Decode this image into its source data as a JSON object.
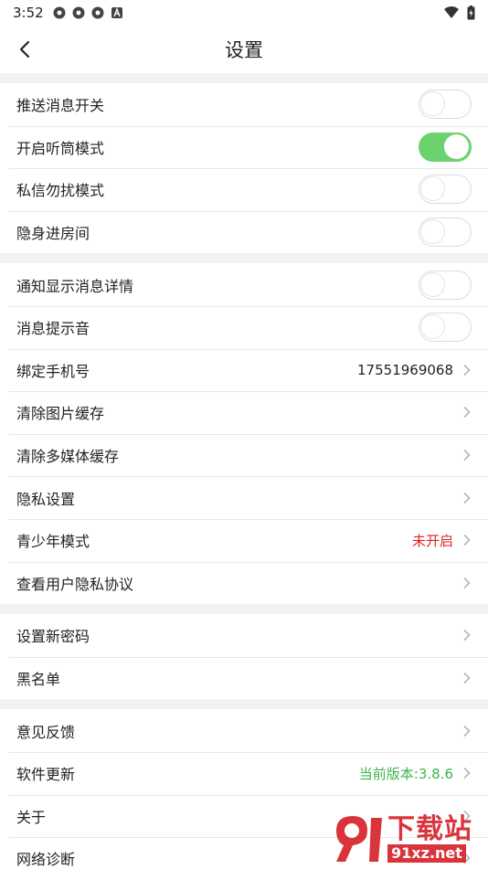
{
  "status_bar": {
    "time": "3:52"
  },
  "header": {
    "title": "设置"
  },
  "groups": [
    [
      {
        "label": "推送消息开关",
        "type": "toggle",
        "on": false
      },
      {
        "label": "开启听筒模式",
        "type": "toggle",
        "on": true
      },
      {
        "label": "私信勿扰模式",
        "type": "toggle",
        "on": false
      },
      {
        "label": "隐身进房间",
        "type": "toggle",
        "on": false
      }
    ],
    [
      {
        "label": "通知显示消息详情",
        "type": "toggle",
        "on": false
      },
      {
        "label": "消息提示音",
        "type": "toggle",
        "on": false
      },
      {
        "label": "绑定手机号",
        "type": "link",
        "value": "17551969068",
        "value_color": "default"
      },
      {
        "label": "清除图片缓存",
        "type": "link"
      },
      {
        "label": "清除多媒体缓存",
        "type": "link"
      },
      {
        "label": "隐私设置",
        "type": "link"
      },
      {
        "label": "青少年模式",
        "type": "link",
        "value": "未开启",
        "value_color": "red"
      },
      {
        "label": "查看用户隐私协议",
        "type": "link"
      }
    ],
    [
      {
        "label": "设置新密码",
        "type": "link"
      },
      {
        "label": "黑名单",
        "type": "link"
      }
    ],
    [
      {
        "label": "意见反馈",
        "type": "link"
      },
      {
        "label": "软件更新",
        "type": "link",
        "value": "当前版本:3.8.6",
        "value_color": "green"
      },
      {
        "label": "关于",
        "type": "link"
      },
      {
        "label": "网络诊断",
        "type": "link"
      }
    ]
  ],
  "watermark": {
    "title": "下载站",
    "site": "91xz.net"
  },
  "colors": {
    "toggle_on": "#6cd26e",
    "red_value": "#e02020",
    "green_value": "#3fb34f",
    "background": "#f2f2f2"
  }
}
